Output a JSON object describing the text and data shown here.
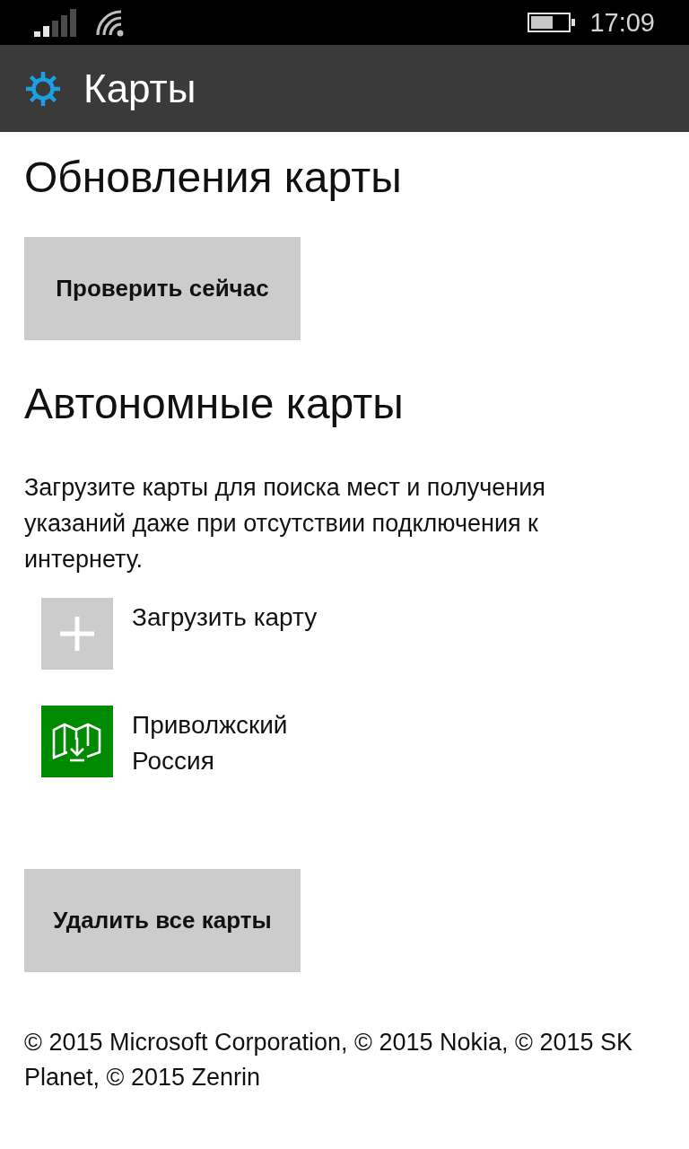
{
  "status_bar": {
    "time": "17:09"
  },
  "header": {
    "title": "Карты"
  },
  "map_updates": {
    "heading": "Обновления карты",
    "button": "Проверить сейчас"
  },
  "offline_maps": {
    "heading": "Автономные карты",
    "description": "Загрузите карты для поиска мест и получения указаний даже при отсутствии подключения к интернету.",
    "items": [
      {
        "kind": "add",
        "label": "Загрузить карту"
      },
      {
        "kind": "map",
        "name": "Приволжский",
        "region": "Россия"
      }
    ],
    "button": "Удалить все карты"
  },
  "copyright": "© 2015 Microsoft Corporation, © 2015 Nokia, © 2015 SK Planet, © 2015 Zenrin"
}
